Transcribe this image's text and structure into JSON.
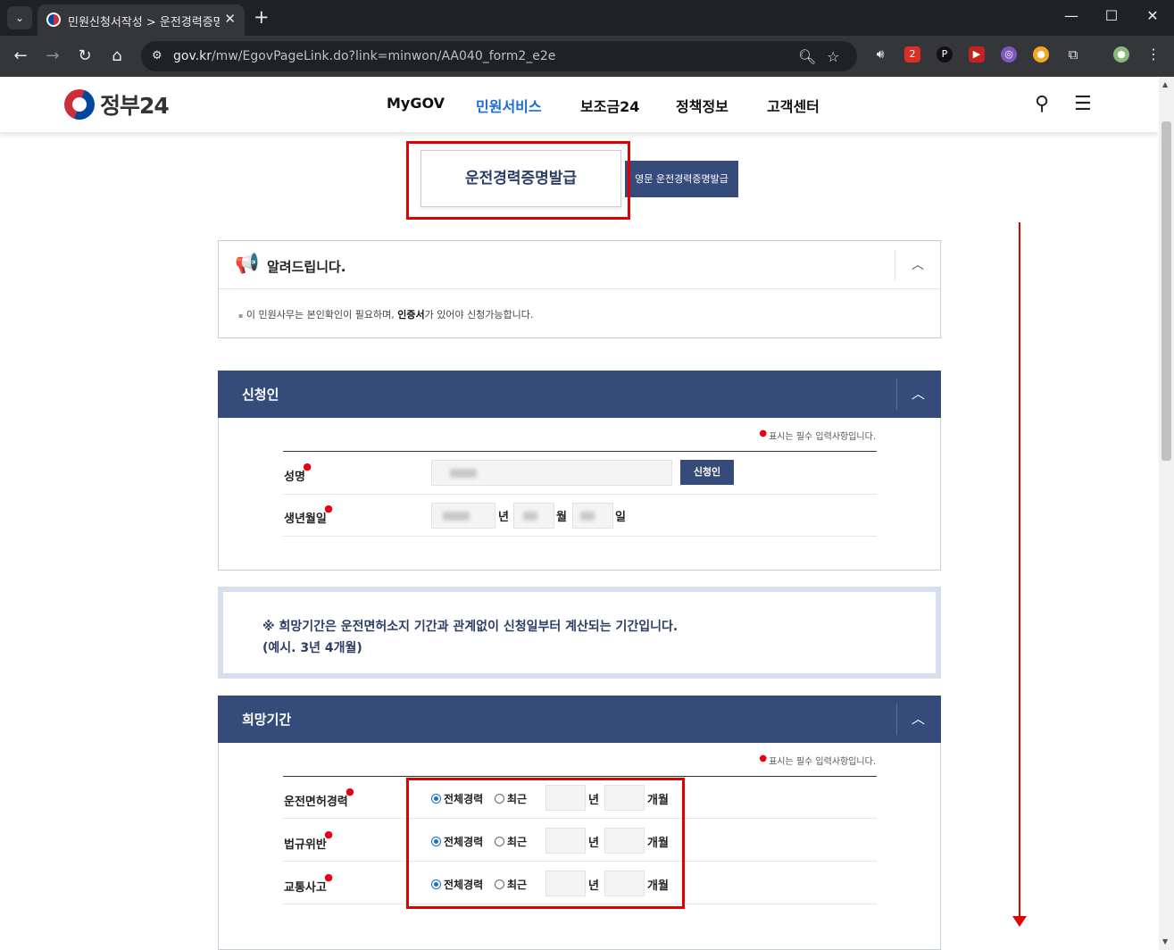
{
  "browser": {
    "tab_title": "민원신청서작성 > 운전경력증명",
    "url_host": "gov.kr",
    "url_path": "/mw/EgovPageLink.do?link=minwon/AA040_form2_e2e"
  },
  "site": {
    "logo_text": "정부24",
    "nav": [
      "MyGOV",
      "민원서비스",
      "보조금24",
      "정책정보",
      "고객센터"
    ]
  },
  "title_button": "운전경력증명발급",
  "english_button": "영문 운전경력증명발급",
  "notice": {
    "title": "알려드립니다.",
    "text_before": "이 민원사무는 본인확인이 필요하며, ",
    "text_bold": "인증서",
    "text_after": "가 있어야 신청가능합니다."
  },
  "applicant": {
    "section_title": "신청인",
    "required_note": "표시는 필수 입력사항입니다.",
    "name_label": "성명",
    "applicant_button": "신청인",
    "birth_label": "생년월일",
    "unit_year": "년",
    "unit_month": "월",
    "unit_day": "일"
  },
  "info_box": {
    "line1": "※ 희망기간은 운전면허소지 기간과 관계없이 신청일부터 계산되는 기간입니다.",
    "line2": "(예시. 3년 4개월)"
  },
  "period": {
    "section_title": "희망기간",
    "required_note": "표시는 필수 입력사항입니다.",
    "option_all": "전체경력",
    "option_recent": "최근",
    "unit_year": "년",
    "unit_month": "개월",
    "rows": [
      {
        "label": "운전면허경력",
        "selected": "전체경력"
      },
      {
        "label": "법규위반",
        "selected": "전체경력"
      },
      {
        "label": "교통사고",
        "selected": "전체경력"
      }
    ]
  }
}
